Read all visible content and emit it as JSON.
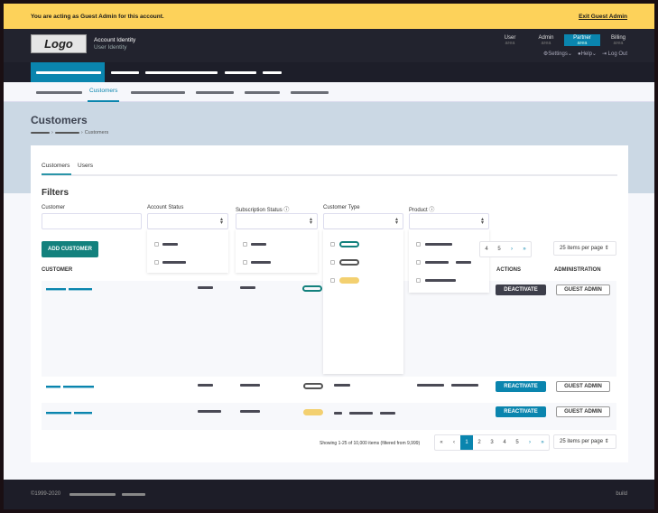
{
  "banner": {
    "message": "You are acting as Guest Admin for this account.",
    "exit_label": "Exit Guest Admin",
    "color": "#fdd25a"
  },
  "header": {
    "logo": "Logo",
    "account": "Account Identity",
    "user": "User Identity",
    "areas": [
      {
        "label": "User",
        "sub": "area"
      },
      {
        "label": "Admin",
        "sub": "area"
      },
      {
        "label": "Partner",
        "sub": "area",
        "active": true
      },
      {
        "label": "Billing",
        "sub": "area"
      }
    ],
    "settings": "Settings",
    "help": "Help",
    "logout": "Log Out"
  },
  "subnav": {
    "current": "Customers"
  },
  "page": {
    "title": "Customers",
    "breadcrumb_current": "Customers"
  },
  "tabs": [
    "Customers",
    "Users"
  ],
  "filters": {
    "title": "Filters",
    "customer_label": "Customer",
    "account_status_label": "Account Status",
    "subscription_status_label": "Subscription Status",
    "customer_type_label": "Customer Type",
    "product_label": "Product",
    "customer_placeholder": ""
  },
  "add_customer": "ADD CUSTOMER",
  "columns": {
    "customer": "CUSTOMER",
    "actions": "ACTIONS",
    "administration": "ADMINISTRATION"
  },
  "rows": [
    {
      "action": "DEACTIVATE",
      "admin": "GUEST ADMIN",
      "type": "teal"
    },
    {
      "action": "REACTIVATE",
      "admin": "GUEST ADMIN",
      "type": "gray"
    },
    {
      "action": "REACTIVATE",
      "admin": "GUEST ADMIN",
      "type": "yellow"
    }
  ],
  "pagination": {
    "summary": "Showing 1-25 of 10,000 items (filtered from 9,999)",
    "pages": [
      "1",
      "2",
      "3",
      "4",
      "5"
    ],
    "current": "1",
    "first": "«",
    "prev": "‹",
    "next": "›",
    "last": "»",
    "per_page": "25 items per page"
  },
  "footer": {
    "copyright": "©1999-2020",
    "build": "build"
  },
  "colors": {
    "accent": "#0a85ae",
    "teal": "#13817d",
    "deactivate": "#3d3e4a",
    "dark": "#22232e"
  }
}
